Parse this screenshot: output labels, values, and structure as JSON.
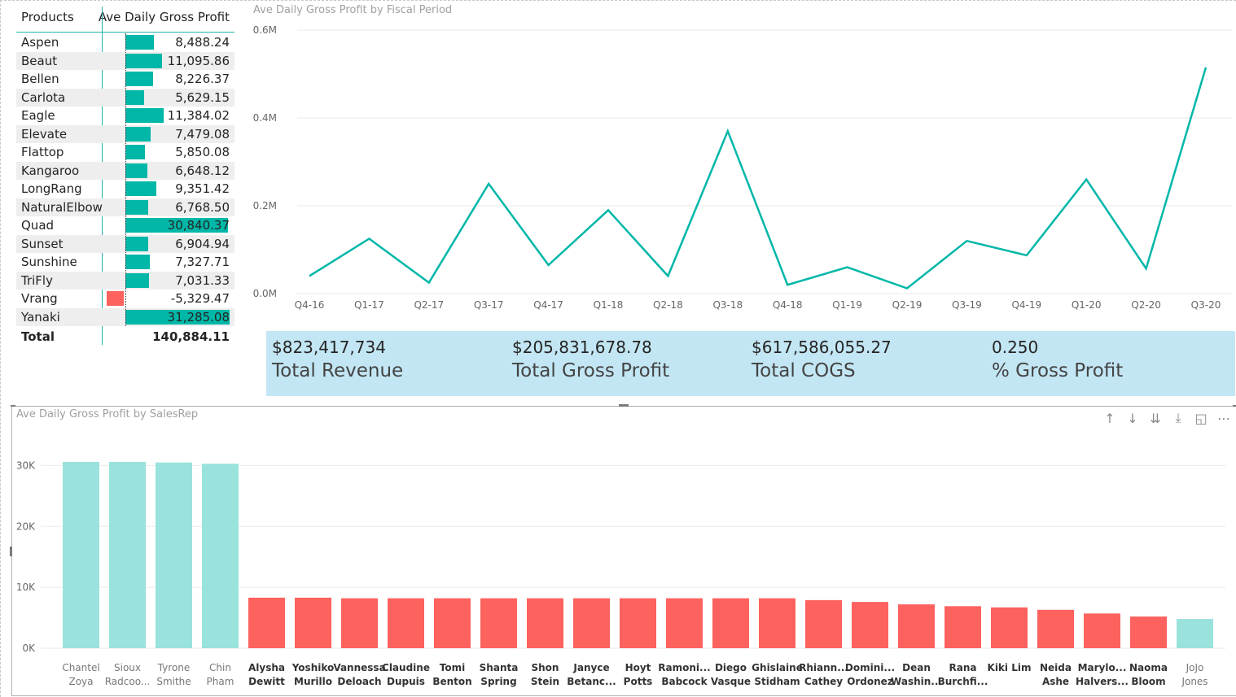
{
  "products_table": {
    "col_products": "Products",
    "col_metric": "Ave Daily Gross Profit",
    "rows": [
      {
        "name": "Aspen",
        "value": "8,488.24",
        "num": 8488.24
      },
      {
        "name": "Beaut",
        "value": "11,095.86",
        "num": 11095.86
      },
      {
        "name": "Bellen",
        "value": "8,226.37",
        "num": 8226.37
      },
      {
        "name": "Carlota",
        "value": "5,629.15",
        "num": 5629.15
      },
      {
        "name": "Eagle",
        "value": "11,384.02",
        "num": 11384.02
      },
      {
        "name": "Elevate",
        "value": "7,479.08",
        "num": 7479.08
      },
      {
        "name": "Flattop",
        "value": "5,850.08",
        "num": 5850.08
      },
      {
        "name": "Kangaroo",
        "value": "6,648.12",
        "num": 6648.12
      },
      {
        "name": "LongRang",
        "value": "9,351.42",
        "num": 9351.42
      },
      {
        "name": "NaturalElbow",
        "value": "6,768.50",
        "num": 6768.5
      },
      {
        "name": "Quad",
        "value": "30,840.37",
        "num": 30840.37
      },
      {
        "name": "Sunset",
        "value": "6,904.94",
        "num": 6904.94
      },
      {
        "name": "Sunshine",
        "value": "7,327.71",
        "num": 7327.71
      },
      {
        "name": "TriFly",
        "value": "7,031.33",
        "num": 7031.33
      },
      {
        "name": "Vrang",
        "value": "-5,329.47",
        "num": -5329.47
      },
      {
        "name": "Yanaki",
        "value": "31,285.08",
        "num": 31285.08
      }
    ],
    "total_label": "Total",
    "total_value": "140,884.11"
  },
  "line_chart_title": "Ave Daily Gross Profit by Fiscal Period",
  "kpis": [
    {
      "value": "$823,417,734",
      "label": "Total Revenue"
    },
    {
      "value": "$205,831,678.78",
      "label": "Total Gross Profit"
    },
    {
      "value": "$617,586,055.27",
      "label": "Total COGS"
    },
    {
      "value": "0.250",
      "label": "% Gross Profit"
    }
  ],
  "bar_chart_title": "Ave Daily Gross Profit by SalesRep",
  "header_icons": [
    "arrow-up-icon",
    "arrow-down-icon",
    "double-arrow-down-icon",
    "expand-hierarchy-icon",
    "focus-mode-icon",
    "more-options-icon"
  ],
  "colors": {
    "teal": "#00b7a8",
    "light_teal": "#99e3dc",
    "red": "#fd625e",
    "kpi_bg": "#c3e6f4"
  },
  "chart_data": [
    {
      "type": "line",
      "title": "Ave Daily Gross Profit by Fiscal Period",
      "x": [
        "Q4-16",
        "Q1-17",
        "Q2-17",
        "Q3-17",
        "Q4-17",
        "Q1-18",
        "Q2-18",
        "Q3-18",
        "Q4-18",
        "Q1-19",
        "Q2-19",
        "Q3-19",
        "Q4-19",
        "Q1-20",
        "Q2-20",
        "Q3-20"
      ],
      "series": [
        {
          "values": [
            0.04,
            0.125,
            0.025,
            0.25,
            0.065,
            0.19,
            0.04,
            0.37,
            0.02,
            0.06,
            0.012,
            0.12,
            0.087,
            0.26,
            0.057,
            0.515
          ]
        }
      ],
      "yticks": [
        "0.0M",
        "0.2M",
        "0.4M",
        "0.6M"
      ],
      "ylim": [
        0,
        0.6
      ],
      "grid": true,
      "color": "#00b7a8"
    },
    {
      "type": "bar",
      "title": "Ave Daily Gross Profit by SalesRep",
      "categories": [
        [
          "Chantel",
          "Zoya"
        ],
        [
          "Sioux",
          "Radcoo..."
        ],
        [
          "Tyrone",
          "Smithe"
        ],
        [
          "Chin",
          "Pham"
        ],
        [
          "Alysha",
          "Dewitt"
        ],
        [
          "Yoshiko",
          "Murillo"
        ],
        [
          "Vannessa",
          "Deloach"
        ],
        [
          "Claudine",
          "Dupuis"
        ],
        [
          "Tomi",
          "Benton"
        ],
        [
          "Shanta",
          "Spring"
        ],
        [
          "Shon",
          "Stein"
        ],
        [
          "Janyce",
          "Betanc..."
        ],
        [
          "Hoyt",
          "Potts"
        ],
        [
          "Ramoni...",
          "Babcock"
        ],
        [
          "Diego",
          "Vasque"
        ],
        [
          "Ghislaine",
          "Stidham"
        ],
        [
          "Rhiann...",
          "Cathey"
        ],
        [
          "Domini...",
          "Ordonez"
        ],
        [
          "Dean",
          "Washin..."
        ],
        [
          "Rana",
          "Burchfi..."
        ],
        [
          "Kiki Lim",
          ""
        ],
        [
          "Neida",
          "Ashe"
        ],
        [
          "Marylo...",
          "Halvers..."
        ],
        [
          "Naoma",
          "Bloom"
        ],
        [
          "JoJo",
          "Jones"
        ]
      ],
      "values": [
        30600,
        30600,
        30500,
        30300,
        8300,
        8300,
        8200,
        8200,
        8200,
        8200,
        8200,
        8200,
        8200,
        8200,
        8200,
        8200,
        7900,
        7600,
        7200,
        6900,
        6700,
        6300,
        5700,
        5200,
        4800
      ],
      "highlight": [
        true,
        true,
        true,
        true,
        false,
        false,
        false,
        false,
        false,
        false,
        false,
        false,
        false,
        false,
        false,
        false,
        false,
        false,
        false,
        false,
        false,
        false,
        false,
        false,
        true
      ],
      "yticks": [
        "0K",
        "10K",
        "20K",
        "30K"
      ],
      "ylim": [
        0,
        35000
      ],
      "grid": true
    }
  ]
}
